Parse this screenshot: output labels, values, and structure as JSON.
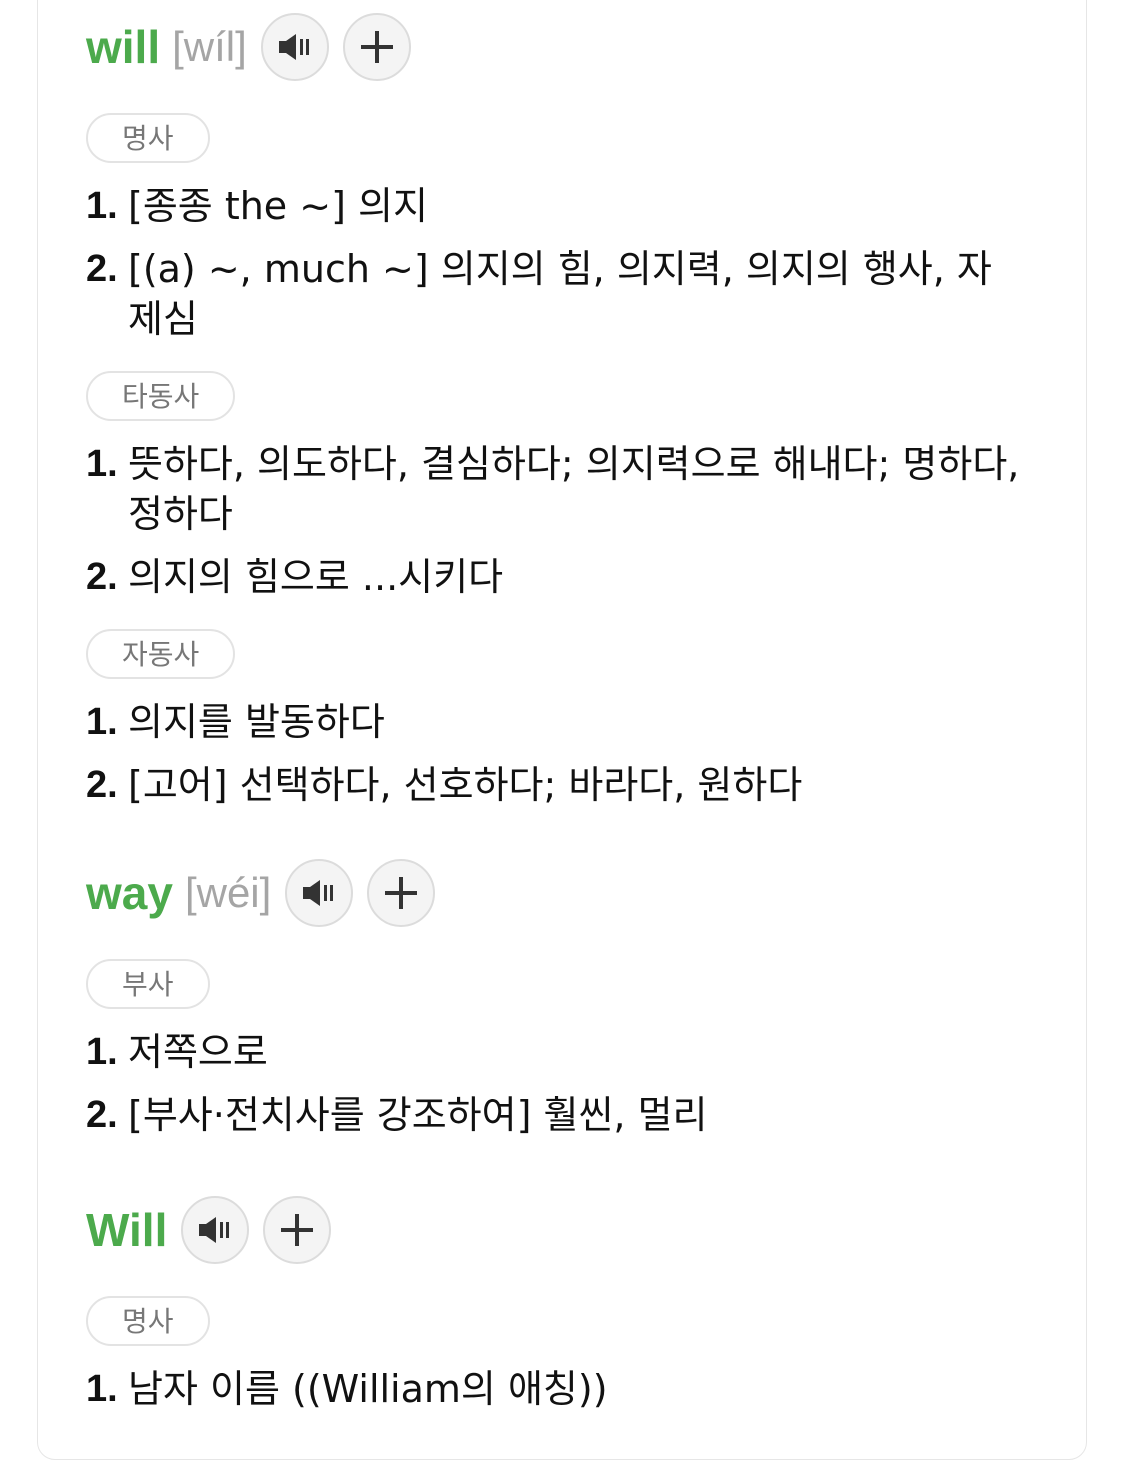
{
  "entries": [
    {
      "word": "will",
      "phonetic": "[wíl]",
      "groups": [
        {
          "pos": "명사",
          "defs": [
            {
              "num": "1.",
              "text": "[종종 the ~] 의지"
            },
            {
              "num": "2.",
              "text": "[(a) ~, much ~] 의지의 힘, 의지력, 의지의 행사, 자제심"
            }
          ]
        },
        {
          "pos": "타동사",
          "defs": [
            {
              "num": "1.",
              "text": "뜻하다, 의도하다, 결심하다; 의지력으로 해내다; 명하다, 정하다"
            },
            {
              "num": "2.",
              "text": "의지의 힘으로 ...시키다"
            }
          ]
        },
        {
          "pos": "자동사",
          "defs": [
            {
              "num": "1.",
              "text": "의지를 발동하다"
            },
            {
              "num": "2.",
              "text": "[고어] 선택하다, 선호하다; 바라다, 원하다"
            }
          ]
        }
      ]
    },
    {
      "word": "way",
      "phonetic": "[wéi]",
      "groups": [
        {
          "pos": "부사",
          "defs": [
            {
              "num": "1.",
              "text": "저쪽으로"
            },
            {
              "num": "2.",
              "text": "[부사·전치사를 강조하여] 훨씬, 멀리"
            }
          ]
        }
      ]
    },
    {
      "word": "Will",
      "phonetic": "",
      "groups": [
        {
          "pos": "명사",
          "defs": [
            {
              "num": "1.",
              "text": "남자 이름 ((William의 애칭))"
            }
          ]
        }
      ]
    }
  ],
  "icons": {
    "speaker": "speaker-icon",
    "add": "plus-icon"
  },
  "colors": {
    "word": "#4caa4c",
    "phonetic": "#a5a5a5",
    "pos_text": "#777777",
    "button_bg": "#f4f4f4"
  }
}
